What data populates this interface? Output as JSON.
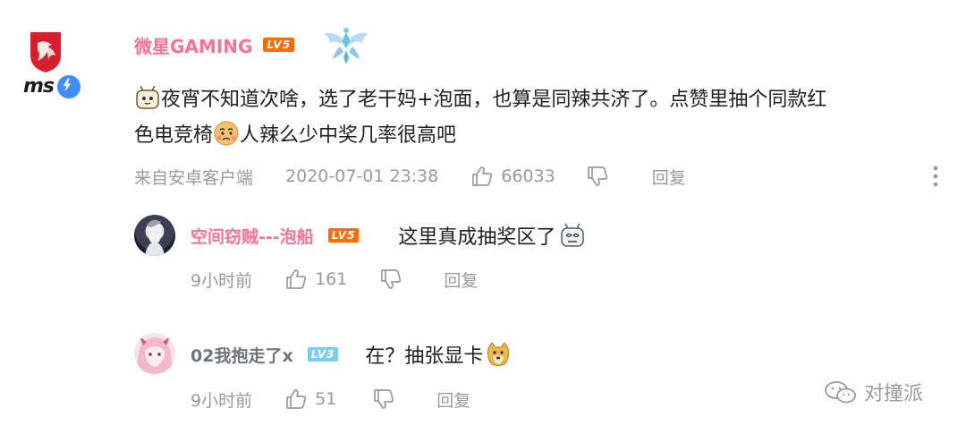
{
  "comment": {
    "username": "微星GAMING",
    "level": "LV5",
    "text_line1": "夜宵不知道次啥，选了老干妈+泡面，也算是同辣共济了。点赞里抽个同款红",
    "text_line2a": "色电竞椅",
    "text_line2b": "人辣么少中奖几率很高吧",
    "source": "来自安卓客户端",
    "timestamp": "2020-07-01 23:38",
    "likes": "66033",
    "reply_label": "回复"
  },
  "replies": [
    {
      "username": "空间窃贼---泡船",
      "level": "LV5",
      "text": "这里真成抽奖区了",
      "time": "9小时前",
      "likes": "161",
      "reply_label": "回复"
    },
    {
      "username": "02我抱走了x",
      "level": "LV3",
      "text": "在？抽张显卡",
      "time": "9小时前",
      "likes": "51",
      "reply_label": "回复"
    }
  ],
  "watermark": "对撞派",
  "colors": {
    "pink_username": "#fb7299",
    "gray_username": "#6d757a",
    "meta_gray": "#9a9a9a",
    "lv5": "#ff6c00",
    "lv3": "#7bcdef",
    "msi_red": "#d5202e"
  },
  "icons": {
    "like": "thumb-up-icon",
    "dislike": "thumb-down-icon",
    "more": "more-vertical-icon"
  }
}
